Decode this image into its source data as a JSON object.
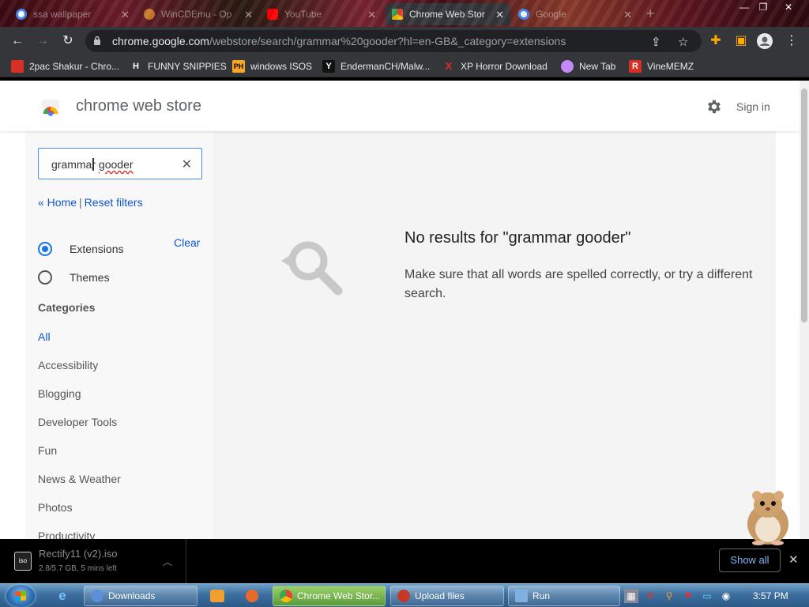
{
  "browser": {
    "tabs": [
      {
        "title": "ssa wallpaper",
        "favicon_color": "#4285f4"
      },
      {
        "title": "WinCDEmu - Op",
        "favicon_color": "#c77a2a"
      },
      {
        "title": "YouTube",
        "favicon_color": "#ff0000"
      },
      {
        "title": "Chrome Web Stor",
        "favicon_color": "#e8453c",
        "active": true
      },
      {
        "title": "Google",
        "favicon_color": "#4285f4"
      }
    ],
    "new_tab_label": "+",
    "url_host": "chrome.google.com",
    "url_path": "/webstore/search/grammar%20gooder?hl=en-GB&_category=extensions",
    "bookmarks": [
      {
        "label": "2pac Shakur - Chro...",
        "icon_text": "",
        "icon_color": "#d93025"
      },
      {
        "label": "FUNNY SNIPPIES",
        "icon_text": "H",
        "icon_color": "#ffffff"
      },
      {
        "label": "windows ISOS",
        "icon_text": "PH",
        "icon_color": "#f9a825"
      },
      {
        "label": "EndermanCH/Malw...",
        "icon_text": "Y",
        "icon_color": "#202124"
      },
      {
        "label": "XP Horror Download",
        "icon_text": "X",
        "icon_color": "#d93025"
      },
      {
        "label": "New Tab",
        "icon_text": "",
        "icon_color": "#c58af9"
      },
      {
        "label": "VineMEMZ",
        "icon_text": "R",
        "icon_color": "#d93025"
      }
    ]
  },
  "store": {
    "title": "chrome web store",
    "sign_in": "Sign in"
  },
  "sidebar": {
    "search_value_a": "gramma",
    "search_value_b": "r ",
    "search_value_c": "gooder",
    "clear_search": "✕",
    "home_link": "« Home",
    "separator": "|",
    "reset_link": "Reset filters",
    "clear_label": "Clear",
    "types": [
      {
        "label": "Extensions",
        "selected": true
      },
      {
        "label": "Themes",
        "selected": false
      }
    ],
    "categories_heading": "Categories",
    "categories": [
      "All",
      "Accessibility",
      "Blogging",
      "Developer Tools",
      "Fun",
      "News & Weather",
      "Photos",
      "Productivity"
    ]
  },
  "results": {
    "title": "No results for \"grammar gooder\"",
    "message": "Make sure that all words are spelled correctly, or try a different search."
  },
  "download": {
    "file_name": "Rectify11 (v2).iso",
    "status": "2.8/5.7 GB, 5 mins left",
    "icon_text": "iso",
    "show_all": "Show all"
  },
  "taskbar": {
    "tasks": [
      {
        "label": "Downloads",
        "icon_color": "#5b8fd8"
      },
      {
        "label": "Chrome Web Stor...",
        "icon_color": "#e8453c",
        "active": true
      },
      {
        "label": "Upload files",
        "icon_color": "#c0392b"
      },
      {
        "label": "Run",
        "icon_color": "#7fb0e0"
      }
    ],
    "time": "3:57 PM"
  }
}
